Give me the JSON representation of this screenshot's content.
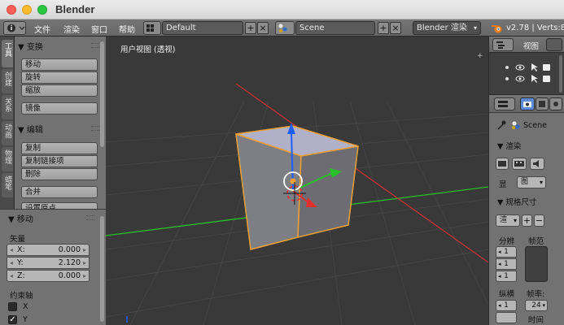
{
  "window": {
    "title": "Blender"
  },
  "header": {
    "editor_icon": "info-icon",
    "menus": [
      "文件",
      "渲染",
      "窗口",
      "帮助"
    ],
    "screen_layout": "Default",
    "scene": "Scene",
    "render_engine": "Blender 渲染",
    "stats": "v2.78 | Verts:8 |"
  },
  "tool_tabs": [
    "工具",
    "创建",
    "关系",
    "动画",
    "物理",
    "蜡笔"
  ],
  "tool_shelf": {
    "transform_panel": "▼ 变换",
    "transform_buttons": [
      "移动",
      "旋转",
      "缩放"
    ],
    "mirror_button": "镜像",
    "edit_panel": "▼ 编辑",
    "edit_buttons": [
      "复制",
      "复制链接项",
      "删除"
    ],
    "join_button": "合并",
    "partial_button": "设置原点"
  },
  "operator": {
    "title": "▼ 移动",
    "vector_label": "矢量",
    "x_label": "X:",
    "x_value": "0.000",
    "y_label": "Y:",
    "y_value": "2.120",
    "z_label": "Z:",
    "z_value": "0.000",
    "constraint_label": "约束轴",
    "axis_x": "X",
    "axis_y": "Y"
  },
  "viewport": {
    "label": "用户视图 (透视)"
  },
  "outliner": {
    "view_menu": "视图"
  },
  "properties": {
    "scene_path": "Scene",
    "render_panel": "▼ 渲染",
    "display_label": "显",
    "display_value": "图",
    "dimensions_panel": "▼ 规格尺寸",
    "preset_label": "渲",
    "resolution_label": "分辨",
    "frame_range_label": "帧范",
    "res_x": "1",
    "res_y": "1",
    "res_pct": "1",
    "aspect_label": "纵横",
    "frame_rate_label": "帧率:",
    "aspect_x": "1",
    "frame_rate_value": "24",
    "time_label": "时间"
  },
  "colors": {
    "x_axis": "#e03030",
    "y_axis": "#28c028",
    "z_axis": "#1f5fff",
    "selection": "#f2a033"
  }
}
